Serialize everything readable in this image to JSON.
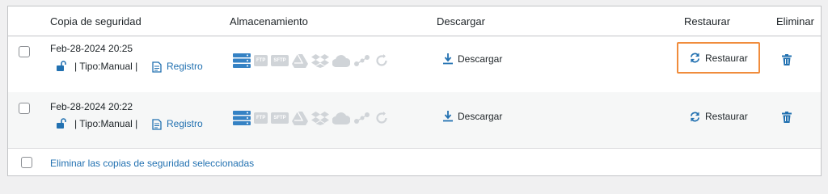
{
  "colors": {
    "accent": "#2271b1",
    "highlight": "#f08c3c",
    "disabled": "#d0d4d8"
  },
  "header": {
    "copia": "Copia de seguridad",
    "almacenamiento": "Almacenamiento",
    "descargar": "Descargar",
    "restaurar": "Restaurar",
    "eliminar": "Eliminar"
  },
  "rows": [
    {
      "date": "Feb-28-2024 20:25",
      "tipo": "| Tipo:Manual |",
      "registro": "Registro",
      "download": "Descargar",
      "restore": "Restaurar",
      "restore_highlighted": true
    },
    {
      "date": "Feb-28-2024 20:22",
      "tipo": "| Tipo:Manual |",
      "registro": "Registro",
      "download": "Descargar",
      "restore": "Restaurar",
      "restore_highlighted": false
    }
  ],
  "storage_icons": {
    "server": "server-icon",
    "ftp": "FTP",
    "sftp": "SFTP",
    "others": [
      "google-drive-icon",
      "dropbox-icon",
      "cloud-icon",
      "cloud-network-icon",
      "refresh-circle-icon"
    ]
  },
  "footer": {
    "bulk_delete": "Eliminar las copias de seguridad seleccionadas"
  }
}
